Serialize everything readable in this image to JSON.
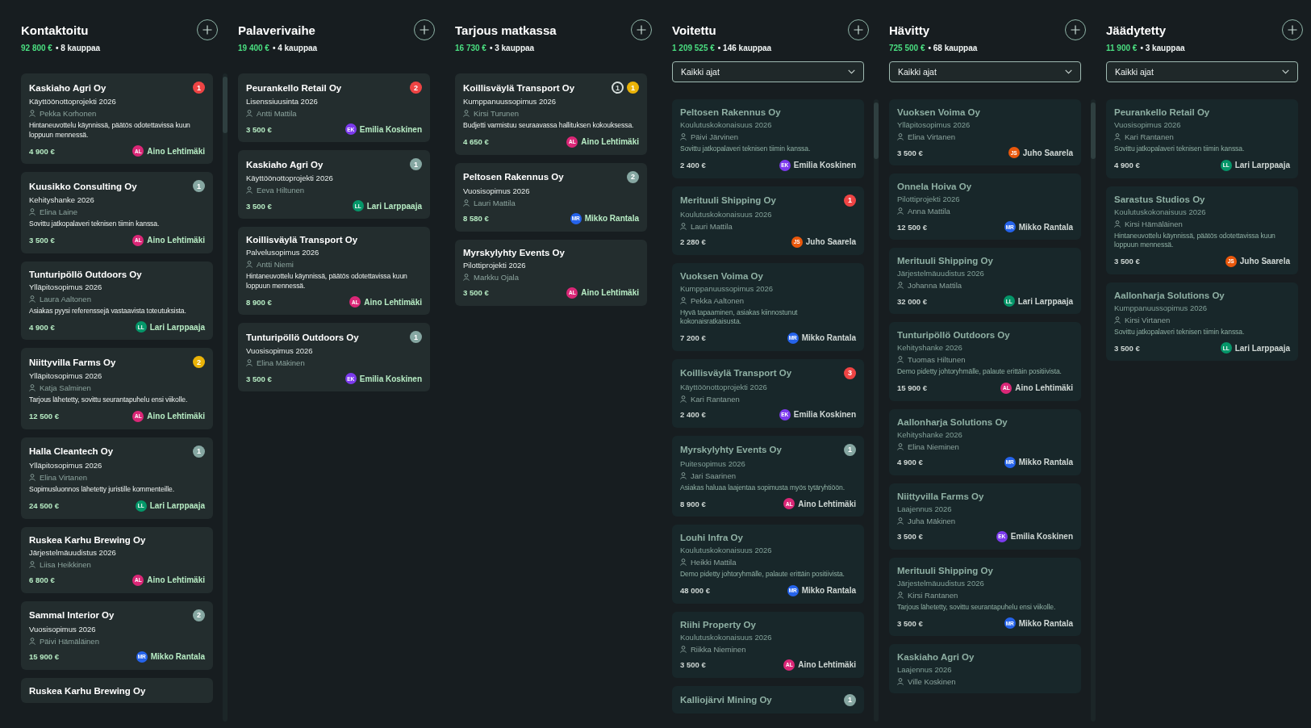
{
  "columns": [
    {
      "title": "Kontaktoitu",
      "amount": "92 800 €",
      "count": "• 8 kauppaa",
      "dimmed": false,
      "scrollbar": true,
      "cards": [
        {
          "company": "Kaskiaho Agri Oy",
          "project": "Käyttöönottoprojekti 2026",
          "contact": "Pekka Korhonen",
          "note": "Hintaneuvottelu käynnissä, päätös odotettavissa kuun loppuun mennessä.",
          "value": "4 900 €",
          "owner": {
            "initials": "AL",
            "name": "Aino Lehtimäki",
            "color": "#db2777"
          },
          "badges": [
            {
              "text": "1",
              "kind": "filled",
              "color": "#ef4444"
            }
          ]
        },
        {
          "company": "Kuusikko Consulting Oy",
          "project": "Kehityshanke 2026",
          "contact": "Elina Laine",
          "note": "Sovittu jatkopalaveri teknisen tiimin kanssa.",
          "value": "3 500 €",
          "owner": {
            "initials": "AL",
            "name": "Aino Lehtimäki",
            "color": "#db2777"
          },
          "badges": [
            {
              "text": "1",
              "kind": "filled",
              "color": "#86a7a2"
            }
          ]
        },
        {
          "company": "Tunturipöllö Outdoors Oy",
          "project": "Ylläpitosopimus 2026",
          "contact": "Laura Aaltonen",
          "note": "Asiakas pyysi referenssejä vastaavista toteutuksista.",
          "value": "4 900 €",
          "owner": {
            "initials": "LL",
            "name": "Lari Larppaaja",
            "color": "#059669"
          }
        },
        {
          "company": "Niittyvilla Farms Oy",
          "project": "Ylläpitosopimus 2026",
          "contact": "Katja Salminen",
          "note": "Tarjous lähetetty, sovittu seurantapuhelu ensi viikolle.",
          "value": "12 500 €",
          "owner": {
            "initials": "AL",
            "name": "Aino Lehtimäki",
            "color": "#db2777"
          },
          "badges": [
            {
              "text": "2",
              "kind": "filled",
              "color": "#eab308"
            }
          ]
        },
        {
          "company": "Halla Cleantech Oy",
          "project": "Ylläpitosopimus 2026",
          "contact": "Elina Virtanen",
          "note": "Sopimusluonnos lähetetty juristille kommenteille.",
          "value": "24 500 €",
          "owner": {
            "initials": "LL",
            "name": "Lari Larppaaja",
            "color": "#059669"
          },
          "badges": [
            {
              "text": "1",
              "kind": "filled",
              "color": "#86a7a2"
            }
          ]
        },
        {
          "company": "Ruskea Karhu Brewing Oy",
          "project": "Järjestelmäuudistus 2026",
          "contact": "Liisa Heikkinen",
          "value": "6 800 €",
          "owner": {
            "initials": "AL",
            "name": "Aino Lehtimäki",
            "color": "#db2777"
          }
        },
        {
          "company": "Sammal Interior Oy",
          "project": "Vuosisopimus 2026",
          "contact": "Päivi Hämäläinen",
          "value": "15 900 €",
          "owner": {
            "initials": "MR",
            "name": "Mikko Rantala",
            "color": "#2563eb"
          },
          "badges": [
            {
              "text": "2",
              "kind": "filled",
              "color": "#86a7a2"
            }
          ]
        },
        {
          "company": "Ruskea Karhu Brewing Oy"
        }
      ]
    },
    {
      "title": "Palaverivaihe",
      "amount": "19 400 €",
      "count": "• 4 kauppaa",
      "dimmed": false,
      "scrollbar": false,
      "cards": [
        {
          "company": "Peurankello Retail Oy",
          "project": "Lisenssiuusinta 2026",
          "contact": "Antti Mattila",
          "value": "3 500 €",
          "owner": {
            "initials": "EK",
            "name": "Emilia Koskinen",
            "color": "#7c3aed"
          },
          "badges": [
            {
              "text": "2",
              "kind": "filled",
              "color": "#ef4444"
            }
          ]
        },
        {
          "company": "Kaskiaho Agri Oy",
          "project": "Käyttöönottoprojekti 2026",
          "contact": "Eeva Hiltunen",
          "value": "3 500 €",
          "owner": {
            "initials": "LL",
            "name": "Lari Larppaaja",
            "color": "#059669"
          },
          "badges": [
            {
              "text": "1",
              "kind": "filled",
              "color": "#86a7a2"
            }
          ]
        },
        {
          "company": "Koillisväylä Transport Oy",
          "project": "Palvelusopimus 2026",
          "contact": "Antti Niemi",
          "note": "Hintaneuvottelu käynnissä, päätös odotettavissa kuun loppuun mennessä.",
          "value": "8 900 €",
          "owner": {
            "initials": "AL",
            "name": "Aino Lehtimäki",
            "color": "#db2777"
          }
        },
        {
          "company": "Tunturipöllö Outdoors Oy",
          "project": "Vuosisopimus 2026",
          "contact": "Elina Mäkinen",
          "value": "3 500 €",
          "owner": {
            "initials": "EK",
            "name": "Emilia Koskinen",
            "color": "#7c3aed"
          },
          "badges": [
            {
              "text": "1",
              "kind": "filled",
              "color": "#86a7a2"
            }
          ]
        }
      ]
    },
    {
      "title": "Tarjous matkassa",
      "amount": "16 730 €",
      "count": "• 3 kauppaa",
      "dimmed": false,
      "scrollbar": false,
      "cards": [
        {
          "company": "Koillisväylä Transport Oy",
          "project": "Kumppanuussopimus 2026",
          "contact": "Kirsi Turunen",
          "note": "Budjetti varmistuu seuraavassa hallituksen kokouksessa.",
          "value": "4 650 €",
          "owner": {
            "initials": "AL",
            "name": "Aino Lehtimäki",
            "color": "#db2777"
          },
          "badges": [
            {
              "text": "1",
              "kind": "outline",
              "color": "#d5dddb"
            },
            {
              "text": "1",
              "kind": "filled",
              "color": "#eab308"
            }
          ]
        },
        {
          "company": "Peltosen Rakennus Oy",
          "project": "Vuosisopimus 2026",
          "contact": "Lauri Mattila",
          "value": "8 580 €",
          "owner": {
            "initials": "MR",
            "name": "Mikko Rantala",
            "color": "#2563eb"
          },
          "badges": [
            {
              "text": "2",
              "kind": "filled",
              "color": "#86a7a2"
            }
          ]
        },
        {
          "company": "Myrskylyhty Events Oy",
          "project": "Pilottiprojekti 2026",
          "contact": "Markku Ojala",
          "value": "3 500 €",
          "owner": {
            "initials": "AL",
            "name": "Aino Lehtimäki",
            "color": "#db2777"
          }
        }
      ]
    },
    {
      "title": "Voitettu",
      "amount": "1 209 525 €",
      "count": "• 146 kauppaa",
      "filter": "Kaikki ajat",
      "dimmed": true,
      "scrollbar": true,
      "cards": [
        {
          "company": "Peltosen Rakennus Oy",
          "project": "Koulutuskokonaisuus 2026",
          "contact": "Päivi Järvinen",
          "note": "Sovittu jatkopalaveri teknisen tiimin kanssa.",
          "value": "2 400 €",
          "owner": {
            "initials": "EK",
            "name": "Emilia Koskinen",
            "color": "#7c3aed"
          }
        },
        {
          "company": "Merituuli Shipping Oy",
          "project": "Koulutuskokonaisuus 2026",
          "contact": "Lauri Mattila",
          "value": "2 280 €",
          "owner": {
            "initials": "JS",
            "name": "Juho Saarela",
            "color": "#ea580c"
          },
          "badges": [
            {
              "text": "1",
              "kind": "filled",
              "color": "#ef4444"
            }
          ]
        },
        {
          "company": "Vuoksen Voima Oy",
          "project": "Kumppanuussopimus 2026",
          "contact": "Pekka Aaltonen",
          "note": "Hyvä tapaaminen, asiakas kiinnostunut kokonaisratkaisusta.",
          "value": "7 200 €",
          "owner": {
            "initials": "MR",
            "name": "Mikko Rantala",
            "color": "#2563eb"
          }
        },
        {
          "company": "Koillisväylä Transport Oy",
          "project": "Käyttöönottoprojekti 2026",
          "contact": "Kari Rantanen",
          "value": "2 400 €",
          "owner": {
            "initials": "EK",
            "name": "Emilia Koskinen",
            "color": "#7c3aed"
          },
          "badges": [
            {
              "text": "3",
              "kind": "filled",
              "color": "#ef4444"
            }
          ]
        },
        {
          "company": "Myrskylyhty Events Oy",
          "project": "Puitesopimus 2026",
          "contact": "Jari Saarinen",
          "note": "Asiakas haluaa laajentaa sopimusta myös tytäryhtiöön.",
          "value": "8 900 €",
          "owner": {
            "initials": "AL",
            "name": "Aino Lehtimäki",
            "color": "#db2777"
          },
          "badges": [
            {
              "text": "1",
              "kind": "filled",
              "color": "#86a7a2"
            }
          ]
        },
        {
          "company": "Louhi Infra Oy",
          "project": "Koulutuskokonaisuus 2026",
          "contact": "Heikki Mattila",
          "note": "Demo pidetty johtoryhmälle, palaute erittäin positiivista.",
          "value": "48 000 €",
          "owner": {
            "initials": "MR",
            "name": "Mikko Rantala",
            "color": "#2563eb"
          }
        },
        {
          "company": "Riihi Property Oy",
          "project": "Koulutuskokonaisuus 2026",
          "contact": "Riikka Nieminen",
          "value": "3 500 €",
          "owner": {
            "initials": "AL",
            "name": "Aino Lehtimäki",
            "color": "#db2777"
          }
        },
        {
          "company": "Kalliojärvi Mining Oy",
          "badges": [
            {
              "text": "1",
              "kind": "filled",
              "color": "#86a7a2"
            }
          ]
        }
      ]
    },
    {
      "title": "Hävitty",
      "amount": "725 500 €",
      "count": "• 68 kauppaa",
      "filter": "Kaikki ajat",
      "dimmed": true,
      "scrollbar": true,
      "cards": [
        {
          "company": "Vuoksen Voima Oy",
          "project": "Ylläpitosopimus 2026",
          "contact": "Elina Virtanen",
          "value": "3 500 €",
          "owner": {
            "initials": "JS",
            "name": "Juho Saarela",
            "color": "#ea580c"
          }
        },
        {
          "company": "Onnela Hoiva Oy",
          "project": "Pilottiprojekti 2026",
          "contact": "Anna Mattila",
          "value": "12 500 €",
          "owner": {
            "initials": "MR",
            "name": "Mikko Rantala",
            "color": "#2563eb"
          }
        },
        {
          "company": "Merituuli Shipping Oy",
          "project": "Järjestelmäuudistus 2026",
          "contact": "Johanna Mattila",
          "value": "32 000 €",
          "owner": {
            "initials": "LL",
            "name": "Lari Larppaaja",
            "color": "#059669"
          }
        },
        {
          "company": "Tunturipöllö Outdoors Oy",
          "project": "Kehityshanke 2026",
          "contact": "Tuomas Hiltunen",
          "note": "Demo pidetty johtoryhmälle, palaute erittäin positiivista.",
          "value": "15 900 €",
          "owner": {
            "initials": "AL",
            "name": "Aino Lehtimäki",
            "color": "#db2777"
          }
        },
        {
          "company": "Aallonharja Solutions Oy",
          "project": "Kehityshanke 2026",
          "contact": "Elina Nieminen",
          "value": "4 900 €",
          "owner": {
            "initials": "MR",
            "name": "Mikko Rantala",
            "color": "#2563eb"
          }
        },
        {
          "company": "Niittyvilla Farms Oy",
          "project": "Laajennus 2026",
          "contact": "Juha Mäkinen",
          "value": "3 500 €",
          "owner": {
            "initials": "EK",
            "name": "Emilia Koskinen",
            "color": "#7c3aed"
          }
        },
        {
          "company": "Merituuli Shipping Oy",
          "project": "Järjestelmäuudistus 2026",
          "contact": "Kirsi Rantanen",
          "note": "Tarjous lähetetty, sovittu seurantapuhelu ensi viikolle.",
          "value": "3 500 €",
          "owner": {
            "initials": "MR",
            "name": "Mikko Rantala",
            "color": "#2563eb"
          }
        },
        {
          "company": "Kaskiaho Agri Oy",
          "project": "Laajennus 2026",
          "contact": "Ville Koskinen"
        }
      ]
    },
    {
      "title": "Jäädytetty",
      "amount": "11 900 €",
      "count": "• 3 kauppaa",
      "filter": "Kaikki ajat",
      "dimmed": true,
      "scrollbar": false,
      "cards": [
        {
          "company": "Peurankello Retail Oy",
          "project": "Vuosisopimus 2026",
          "contact": "Kari Rantanen",
          "note": "Sovittu jatkopalaveri teknisen tiimin kanssa.",
          "value": "4 900 €",
          "owner": {
            "initials": "LL",
            "name": "Lari Larppaaja",
            "color": "#059669"
          }
        },
        {
          "company": "Sarastus Studios Oy",
          "project": "Koulutuskokonaisuus 2026",
          "contact": "Kirsi Hämäläinen",
          "note": "Hintaneuvottelu käynnissä, päätös odotettavissa kuun loppuun mennessä.",
          "value": "3 500 €",
          "owner": {
            "initials": "JS",
            "name": "Juho Saarela",
            "color": "#ea580c"
          }
        },
        {
          "company": "Aallonharja Solutions Oy",
          "project": "Kumppanuussopimus 2026",
          "contact": "Kirsi Virtanen",
          "note": "Sovittu jatkopalaveri teknisen tiimin kanssa.",
          "value": "3 500 €",
          "owner": {
            "initials": "LL",
            "name": "Lari Larppaaja",
            "color": "#059669"
          }
        }
      ]
    }
  ]
}
